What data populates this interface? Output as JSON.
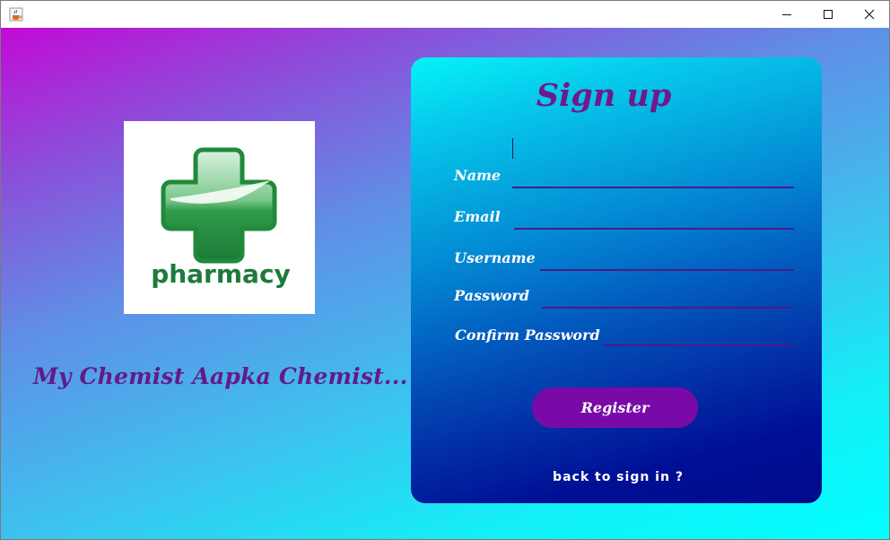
{
  "window": {
    "app_icon": "java-coffee-cup-icon",
    "controls": [
      "minimize-icon",
      "maximize-icon",
      "close-icon"
    ]
  },
  "brand": {
    "logo_icon": "pharmacy-cross-logo",
    "logo_text": "pharmacy",
    "tagline": "My Chemist Aapka Chemist..."
  },
  "signup": {
    "title": "Sign up",
    "fields": {
      "name": {
        "label": "Name",
        "value": ""
      },
      "email": {
        "label": "Email",
        "value": ""
      },
      "username": {
        "label": "Username",
        "value": ""
      },
      "password": {
        "label": "Password",
        "value": ""
      },
      "confirm_password": {
        "label": "Confirm Password",
        "value": ""
      }
    },
    "register_label": "Register",
    "back_link": "back to sign in ?"
  },
  "colors": {
    "title_purple": "#6e1a8c",
    "underline_purple": "#4b1a8a",
    "button_purple": "#7a0aa8",
    "logo_green": "#2e8b3a"
  }
}
